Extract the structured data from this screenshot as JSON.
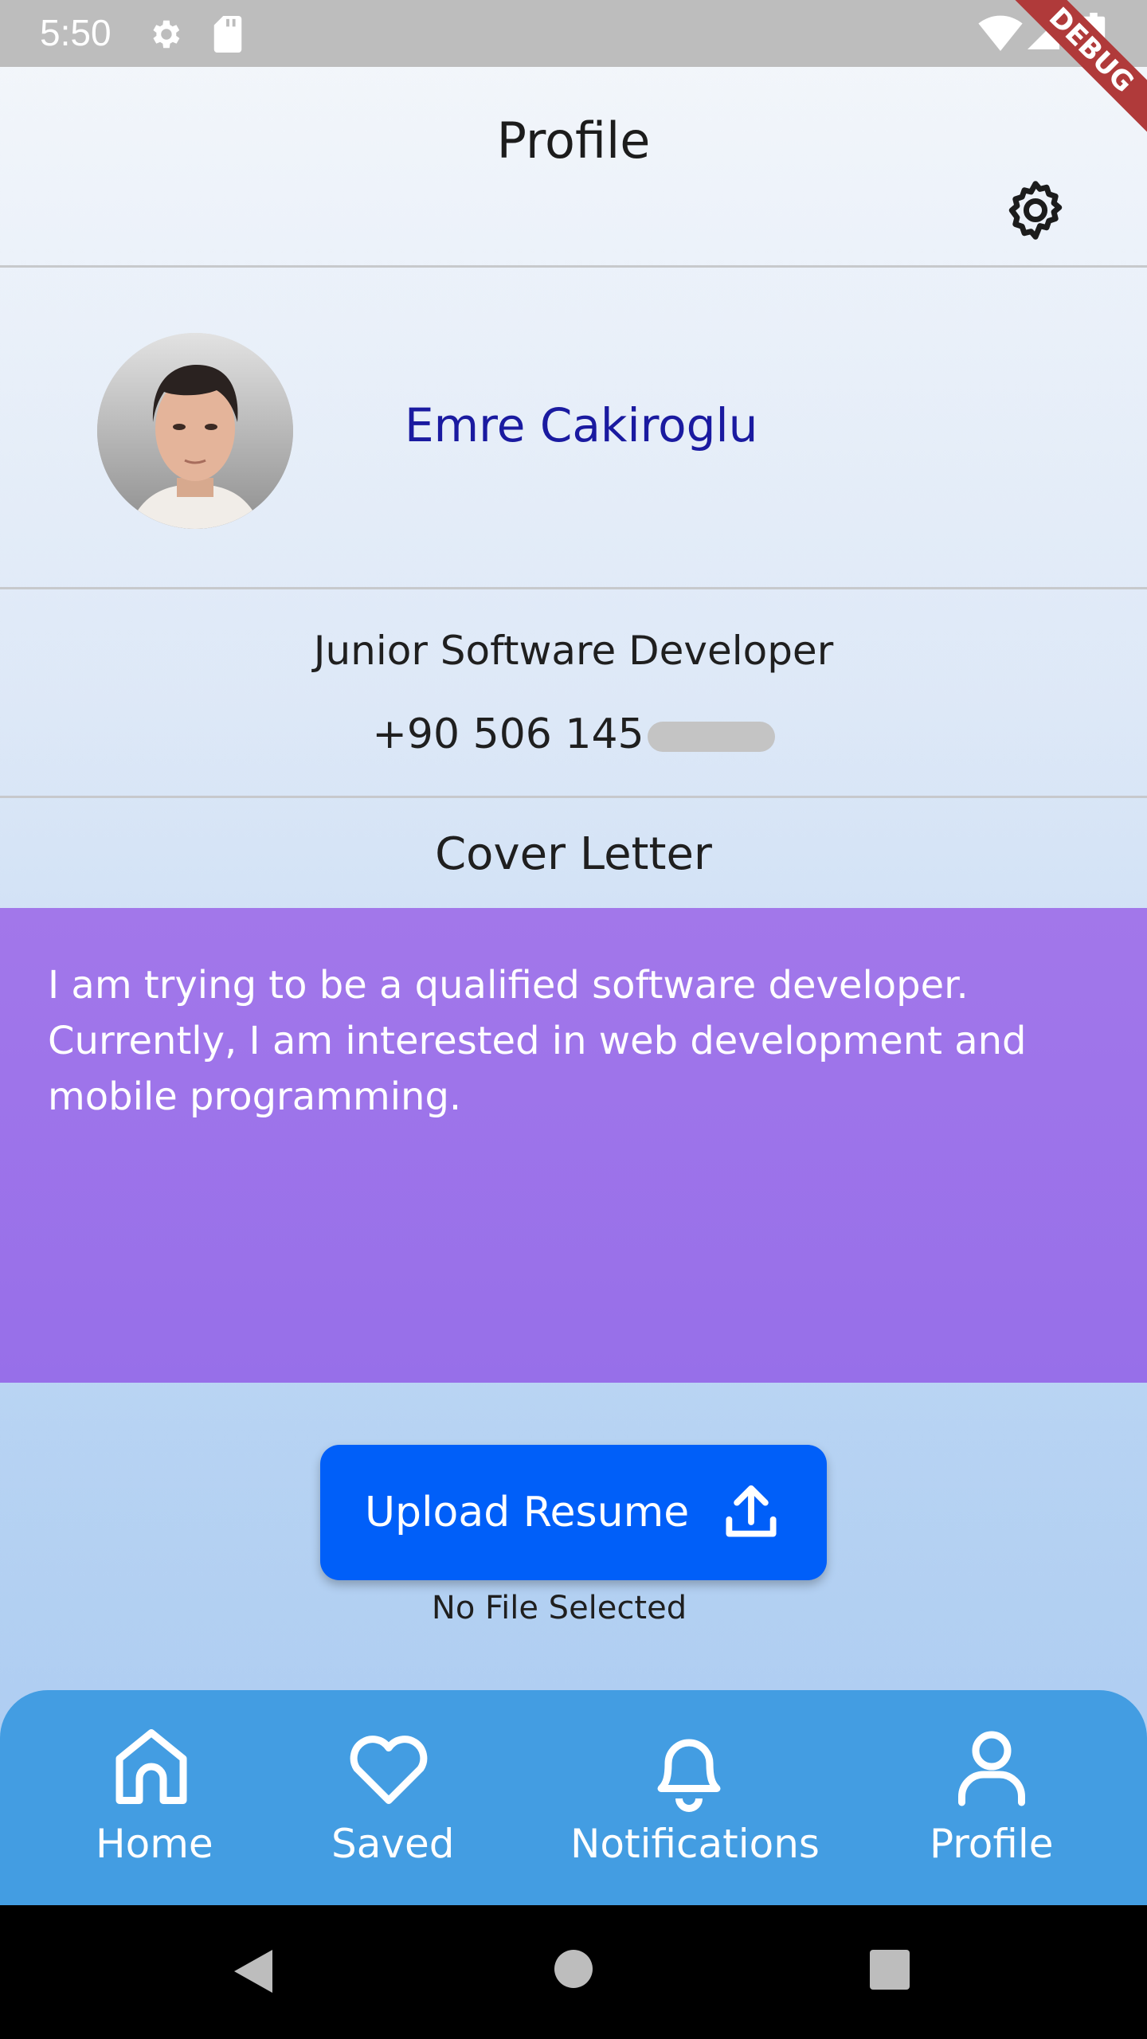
{
  "status_bar": {
    "time": "5:50",
    "icons": [
      "gear-icon",
      "sd-card-icon",
      "wifi-icon",
      "signal-icon",
      "battery-icon"
    ]
  },
  "debug_banner": "DEBUG",
  "header": {
    "title": "Profile",
    "settings_icon": "gear-icon"
  },
  "profile": {
    "name": "Emre Cakiroglu",
    "job_title": "Junior Software Developer",
    "phone_visible": "+90 506 145"
  },
  "cover_letter": {
    "heading": "Cover Letter",
    "text": "I am trying to be a qualified software developer. Currently, I am interested in web development and mobile programming."
  },
  "upload": {
    "button_label": "Upload Resume",
    "icon": "upload-icon",
    "file_status": "No File Selected"
  },
  "bottom_nav": {
    "items": [
      {
        "label": "Home",
        "icon": "home-icon"
      },
      {
        "label": "Saved",
        "icon": "heart-icon"
      },
      {
        "label": "Notifications",
        "icon": "bell-icon"
      },
      {
        "label": "Profile",
        "icon": "user-icon"
      }
    ]
  },
  "colors": {
    "status_bar": "#bdbdbd",
    "name_text": "#1a1aa0",
    "cover_box": "#9b71e9",
    "upload_button": "#005ff9",
    "bottom_nav": "#439de2",
    "debug_banner": "#b03a3a"
  }
}
